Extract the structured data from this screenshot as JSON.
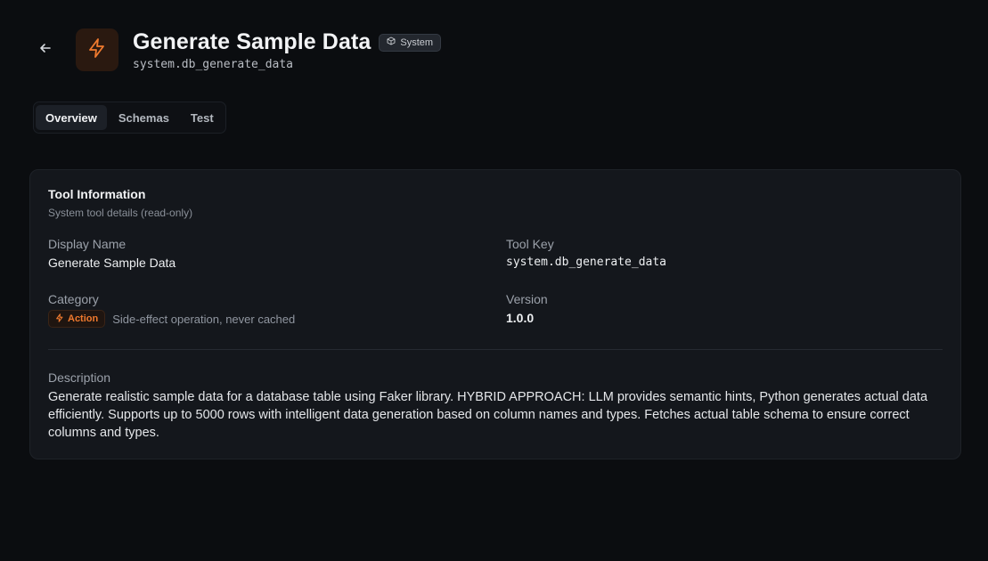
{
  "header": {
    "title": "Generate Sample Data",
    "badge": "System",
    "key": "system.db_generate_data",
    "back_icon": "arrow-left-icon",
    "tool_icon": "lightning-icon",
    "accent_color": "#f07a2e"
  },
  "tabs": [
    {
      "label": "Overview",
      "active": true
    },
    {
      "label": "Schemas",
      "active": false
    },
    {
      "label": "Test",
      "active": false
    }
  ],
  "card": {
    "title": "Tool Information",
    "subtitle": "System tool details (read-only)",
    "display_name_label": "Display Name",
    "display_name_value": "Generate Sample Data",
    "tool_key_label": "Tool Key",
    "tool_key_value": "system.db_generate_data",
    "category_label": "Category",
    "category_badge": "Action",
    "category_note": "Side-effect operation, never cached",
    "version_label": "Version",
    "version_value": "1.0.0",
    "description_label": "Description",
    "description_value": "Generate realistic sample data for a database table using Faker library. HYBRID APPROACH: LLM provides semantic hints, Python generates actual data efficiently. Supports up to 5000 rows with intelligent data generation based on column names and types. Fetches actual table schema to ensure correct columns and types."
  }
}
